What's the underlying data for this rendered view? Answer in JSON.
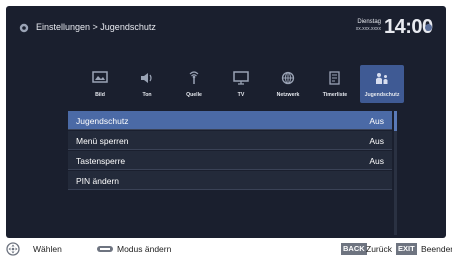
{
  "header": {
    "breadcrumb": "Einstellungen > Jugendschutz",
    "weekday": "Dienstag",
    "date": "xx.xxx.xxxx",
    "time": "14:00"
  },
  "tabs": [
    {
      "label": "Bild",
      "icon": "picture-icon",
      "active": false
    },
    {
      "label": "Ton",
      "icon": "speaker-icon",
      "active": false
    },
    {
      "label": "Quelle",
      "icon": "source-icon",
      "active": false
    },
    {
      "label": "TV",
      "icon": "tv-icon",
      "active": false
    },
    {
      "label": "Netzwerk",
      "icon": "network-icon",
      "active": false
    },
    {
      "label": "Timerliste",
      "icon": "timer-list-icon",
      "active": false
    },
    {
      "label": "Jugendschutz",
      "icon": "parental-lock-icon",
      "active": true
    }
  ],
  "menu": [
    {
      "label": "Jugendschutz",
      "value": "Aus",
      "selected": true
    },
    {
      "label": "Menü sperren",
      "value": "Aus",
      "selected": false
    },
    {
      "label": "Tastensperre",
      "value": "Aus",
      "selected": false
    },
    {
      "label": "PIN ändern",
      "value": "",
      "selected": false
    }
  ],
  "footer": {
    "select_label": "Wählen",
    "mode_label": "Modus ändern",
    "back_key": "BACK",
    "back_label": "Zurück",
    "exit_key": "EXIT",
    "exit_label": "Beenden"
  },
  "colors": {
    "background": "#1a1f2e",
    "selected_row": "#4b6aa6",
    "active_tab": "#3f5a94"
  }
}
